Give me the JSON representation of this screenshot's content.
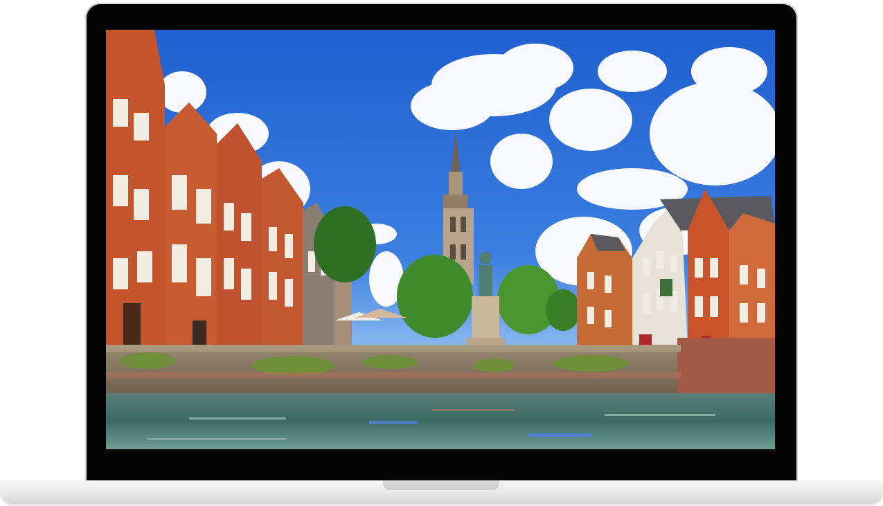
{
  "device": {
    "type": "laptop-mockup",
    "bezel_color": "#050505",
    "base_color": "#e9e9e9"
  },
  "screen_content": {
    "subject": "canal-city-scene",
    "colors": {
      "sky": "#2f6fd8",
      "sky_light": "#7fb1ef",
      "cloud": "#f7f9fc",
      "brick": "#c4542c",
      "brick_dark": "#8e3a1e",
      "roof": "#5a5a5e",
      "tree": "#3f8a2a",
      "wall": "#8a7a66",
      "moss": "#6f8f3a",
      "water": "#3b6a62",
      "water_light": "#7fa7a0",
      "tower": "#b8a48a",
      "statue": "#4e7f72"
    }
  }
}
